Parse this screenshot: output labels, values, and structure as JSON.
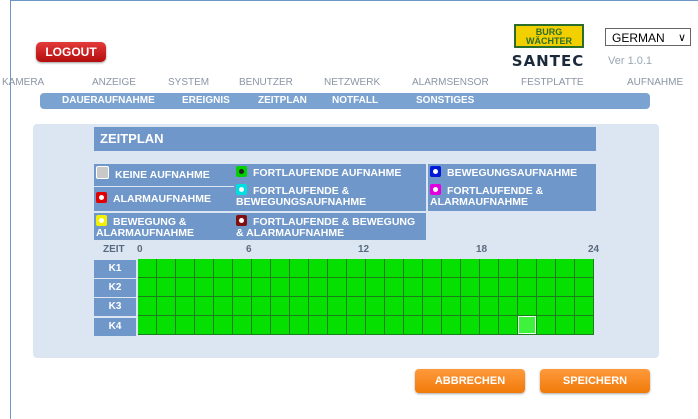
{
  "header": {
    "logout_label": "LOGOUT",
    "logo_top": "BURG WÄCHTER",
    "logo_bottom": "SANTEC",
    "language": "GERMAN",
    "version": "Ver 1.0.1"
  },
  "main_nav": [
    "KAMERA",
    "ANZEIGE",
    "SYSTEM",
    "BENUTZER",
    "NETZWERK",
    "ALARMSENSOR",
    "FESTPLATTE",
    "AUFNAHME"
  ],
  "sub_nav": [
    "DAUERAUFNAHME",
    "EREIGNIS",
    "ZEITPLAN",
    "NOTFALL",
    "SONSTIGES"
  ],
  "section_title": "ZEITPLAN",
  "legend": [
    {
      "label": "KEINE AUFNAHME",
      "color": "#c8c8c8"
    },
    {
      "label": "FORTLAUFENDE AUFNAHME",
      "color": "#00d000"
    },
    {
      "label": "BEWEGUNGSAUFNAHME",
      "color": "#0018d8"
    },
    {
      "label": "ALARMAUFNAHME",
      "color": "#e00000"
    },
    {
      "label": "FORTLAUFENDE & BEWEGUNGSAUFNAHME",
      "color": "#00e0e0"
    },
    {
      "label": "FORTLAUFENDE & ALARMAUFNAHME",
      "color": "#e000e0"
    },
    {
      "label": "BEWEGUNG & ALARMAUFNAHME",
      "color": "#f0f000"
    },
    {
      "label": "FORTLAUFENDE & BEWEGUNG & ALARMAUFNAHME",
      "color": "#801010"
    }
  ],
  "schedule": {
    "zeit_label": "ZEIT",
    "hour_ticks": [
      "0",
      "6",
      "12",
      "18",
      "24"
    ],
    "channels": [
      "K1",
      "K2",
      "K3",
      "K4"
    ],
    "slot_color": "#06e000",
    "slots_per_channel": 24,
    "selected_slot": {
      "channel": "K4",
      "index": 20
    }
  },
  "buttons": {
    "cancel": "ABBRECHEN",
    "save": "SPEICHERN"
  }
}
